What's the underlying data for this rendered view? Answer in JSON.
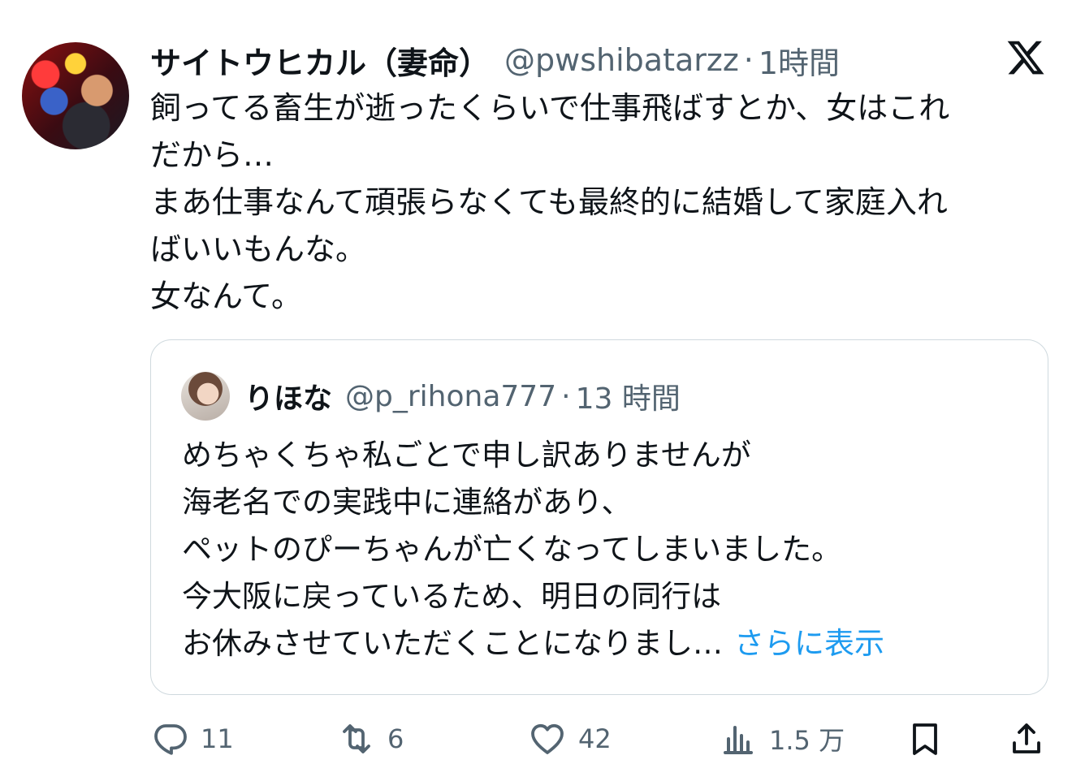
{
  "tweet": {
    "author_name": "サイトウヒカル（妻命）",
    "handle": "@pwshibatarzz",
    "separator": "·",
    "time": "1時間",
    "text_lines": [
      "飼ってる畜生が逝ったくらいで仕事飛ばすとか、女はこれ",
      "だから…",
      "まあ仕事なんて頑張らなくても最終的に結婚して家庭入れ",
      "ばいいもんな。",
      "女なんて。"
    ]
  },
  "quoted": {
    "author_name": "りほな",
    "handle": "@p_rihona777",
    "separator": "·",
    "time": "13 時間",
    "text_lines": [
      "めちゃくちゃ私ごとで申し訳ありませんが",
      "海老名での実践中に連絡があり、",
      "ペットのぴーちゃんが亡くなってしまいました。",
      "今大阪に戻っているため、明日の同行は",
      "お休みさせていただくことになりまし…"
    ],
    "show_more": "さらに表示"
  },
  "actions": {
    "reply_count": "11",
    "repost_count": "6",
    "like_count": "42",
    "views_count": "1.5 万"
  },
  "icons": [
    "x-logo-icon",
    "reply-icon",
    "repost-icon",
    "like-icon",
    "views-icon",
    "bookmark-icon",
    "share-icon"
  ],
  "colors": {
    "text": "#0f1419",
    "secondary": "#536471",
    "link": "#1d9bf0",
    "border": "#cfd9de"
  }
}
